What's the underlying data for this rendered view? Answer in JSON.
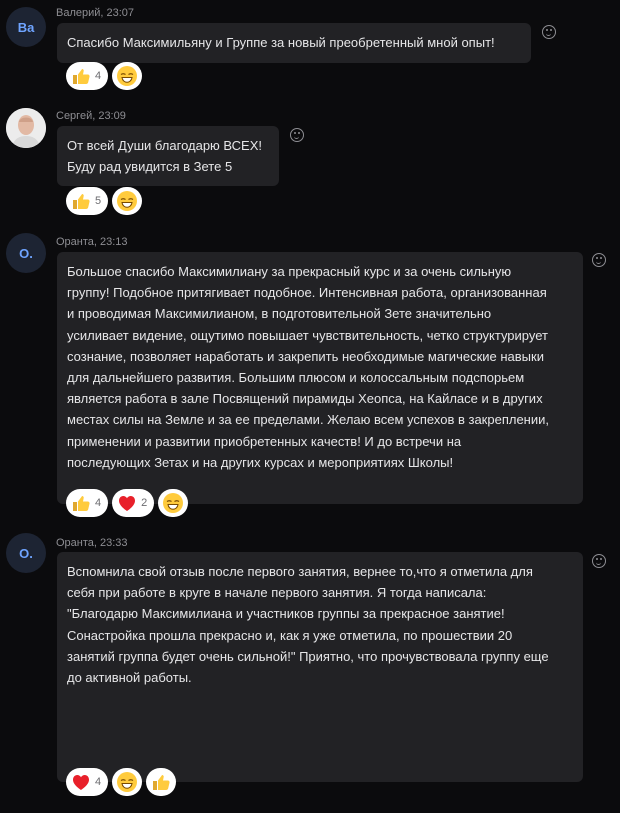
{
  "messages": [
    {
      "author_time": "Валерий, 23:07",
      "avatar_initials": "Ва",
      "text": "Спасибо Максимильяну и Группе за новый преобретенный мной опыт!",
      "reactions": [
        {
          "emoji": "thumbs-up",
          "count": "4"
        },
        {
          "emoji": "grin",
          "count": ""
        }
      ]
    },
    {
      "author_time": "Сергей, 23:09",
      "avatar_initials": "",
      "text": "От всей Души благодарю ВСЕХ!\nБуду рад увидится в Зете 5",
      "reactions": [
        {
          "emoji": "thumbs-up",
          "count": "5"
        },
        {
          "emoji": "grin",
          "count": ""
        }
      ]
    },
    {
      "author_time": "Оранта, 23:13",
      "avatar_initials": "О.",
      "text": "Большое спасибо Максимилиану за прекрасный курс и за очень сильную\nгруппу! Подобное притягивает подобное. Интенсивная работа, организованная\nи проводимая Максимилианом, в подготовительной Зете значительно\nусиливает видение, ощутимо повышает чувствительность, четко структурирует\nсознание, позволяет наработать и закрепить необходимые магические навыки\nдля дальнейшего развития. Большим плюсом и колоссальным подспорьем\nявляется работа в зале Посвящений пирамиды Хеопса, на Кайласе и в других\nместах силы на Земле и за ее пределами. Желаю всем успехов в закреплении,\nприменении и развитии приобретенных качеств! И до встречи на\nпоследующих Зетах и на других курсах и мероприятиях Школы!",
      "reactions": [
        {
          "emoji": "thumbs-up",
          "count": "4"
        },
        {
          "emoji": "heart",
          "count": "2"
        },
        {
          "emoji": "grin",
          "count": ""
        }
      ]
    },
    {
      "author_time": "Оранта, 23:33",
      "avatar_initials": "О.",
      "text": "Вспомнила свой отзыв после первого занятия, вернее то,что я отметила для\nсебя при работе в круге в начале первого занятия.  Я тогда написала:\n\"Благодарю Максимилиана и участников группы за прекрасное занятие!\nСонастройка прошла прекрасно и, как я уже отметила, по прошествии 20\nзанятий группа будет очень сильной!\" Приятно, что прочувствовала группу еще\nдо активной работы.",
      "reactions": [
        {
          "emoji": "heart",
          "count": "4"
        },
        {
          "emoji": "grin",
          "count": ""
        },
        {
          "emoji": "thumbs-up",
          "count": ""
        }
      ]
    }
  ],
  "colors": {
    "background": "#0b0b0d",
    "bubble": "#222225",
    "avatar_text": "#6fa4ff",
    "meta_text": "#8e8e93"
  }
}
